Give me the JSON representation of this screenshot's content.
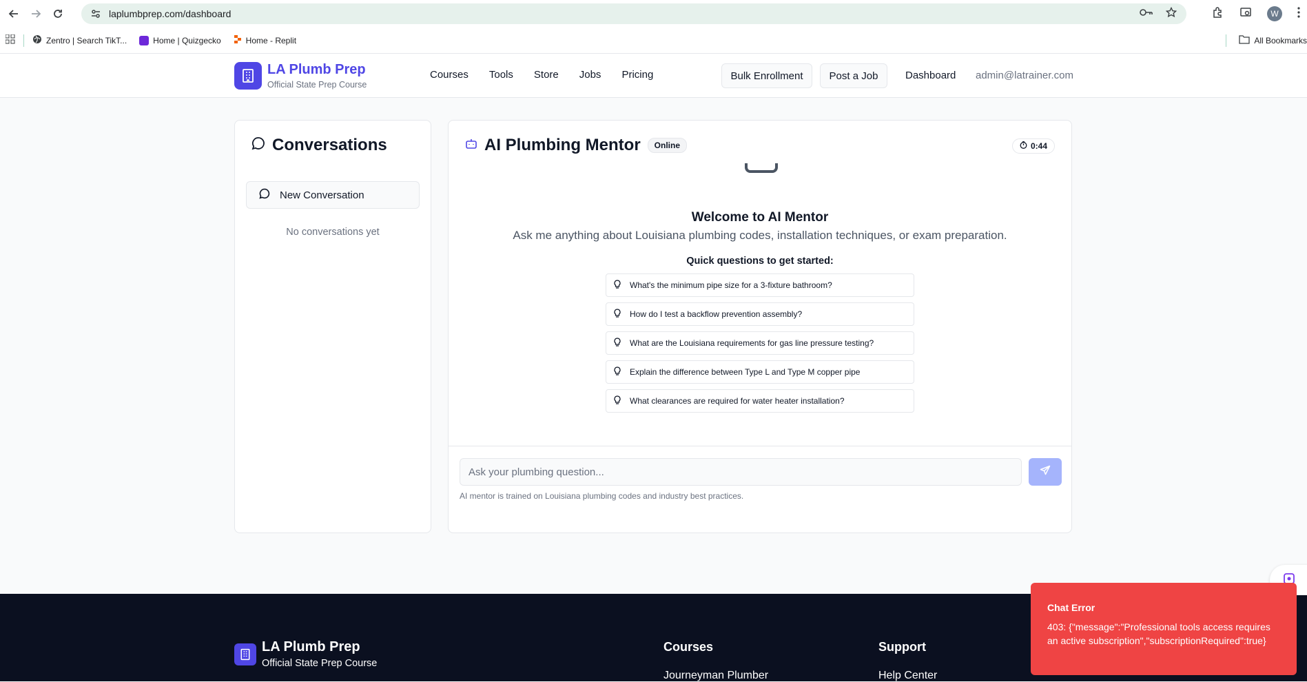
{
  "browser": {
    "url": "laplumbprep.com/dashboard",
    "avatar_initial": "W",
    "bookmarks": [
      {
        "label": "Zentro | Search TikT...",
        "color": "#3c4043"
      },
      {
        "label": "Home | Quizgecko",
        "color": "#6d28d9"
      },
      {
        "label": "Home - Replit",
        "color": "#f26207"
      }
    ],
    "all_bookmarks_label": "All Bookmarks"
  },
  "header": {
    "brand_name": "LA Plumb Prep",
    "brand_subtitle": "Official State Prep Course",
    "nav": [
      "Courses",
      "Tools",
      "Store",
      "Jobs",
      "Pricing"
    ],
    "bulk_enrollment_label": "Bulk Enrollment",
    "post_job_label": "Post a Job",
    "dashboard_label": "Dashboard",
    "user_email": "admin@latrainer.com"
  },
  "conversations": {
    "title": "Conversations",
    "new_conversation_label": "New Conversation",
    "empty_text": "No conversations yet"
  },
  "mentor": {
    "title": "AI Plumbing Mentor",
    "status": "Online",
    "timer": "0:44",
    "welcome_title": "Welcome to AI Mentor",
    "welcome_subtitle": "Ask me anything about Louisiana plumbing codes, installation techniques, or exam preparation.",
    "quick_label": "Quick questions to get started:",
    "quick_questions": [
      "What's the minimum pipe size for a 3-fixture bathroom?",
      "How do I test a backflow prevention assembly?",
      "What are the Louisiana requirements for gas line pressure testing?",
      "Explain the difference between Type L and Type M copper pipe",
      "What clearances are required for water heater installation?"
    ],
    "input_placeholder": "Ask your plumbing question...",
    "footnote": "AI mentor is trained on Louisiana plumbing codes and industry best practices."
  },
  "footer": {
    "brand_name": "LA Plumb Prep",
    "brand_subtitle": "Official State Prep Course",
    "courses_title": "Courses",
    "courses_first_link": "Journeyman Plumber",
    "support_title": "Support",
    "support_first_link": "Help Center"
  },
  "toast": {
    "title": "Chat Error",
    "message": "403: {\"message\":\"Professional tools access requires an active subscription\",\"subscriptionRequired\":true}"
  },
  "colors": {
    "brand": "#4f46e5",
    "error": "#ef4444",
    "footer_bg": "#0b1020",
    "send_disabled": "#a5b4fc"
  }
}
